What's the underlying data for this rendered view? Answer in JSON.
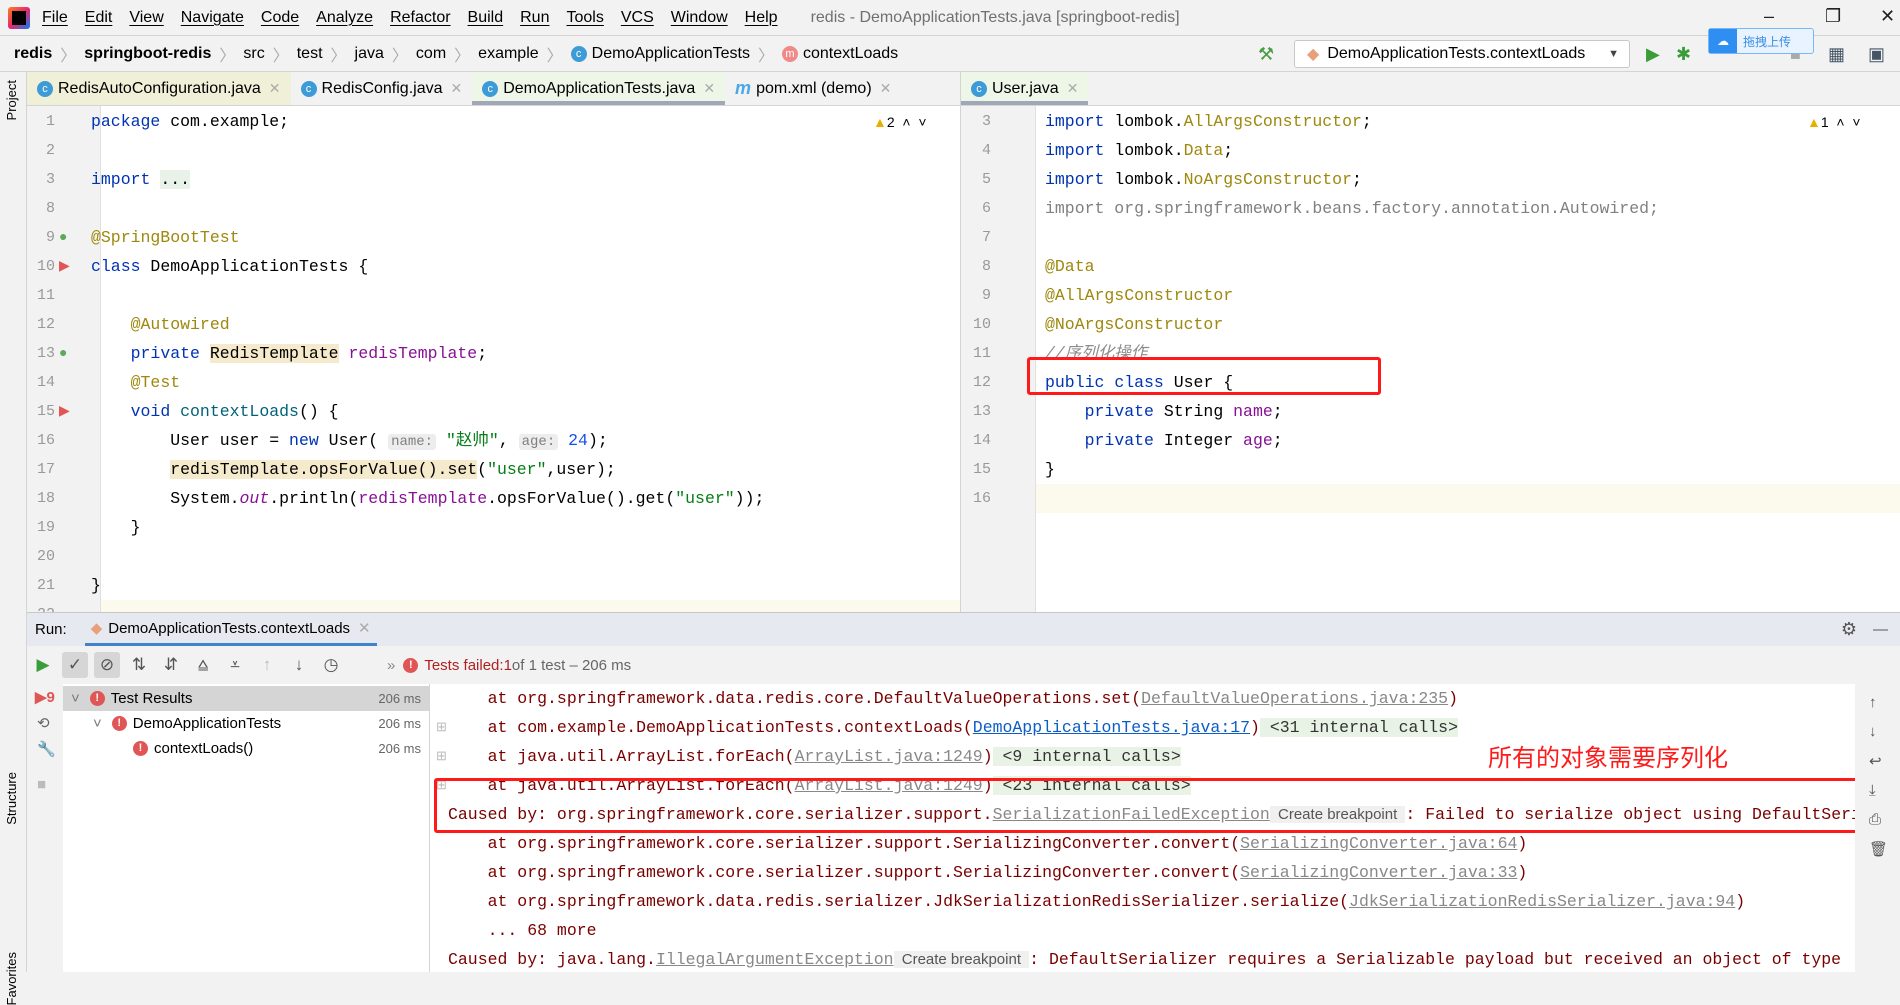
{
  "menu": {
    "items": [
      "File",
      "Edit",
      "View",
      "Navigate",
      "Code",
      "Analyze",
      "Refactor",
      "Build",
      "Run",
      "Tools",
      "VCS",
      "Window",
      "Help"
    ],
    "title": "redis - DemoApplicationTests.java [springboot-redis]"
  },
  "breadcrumb": [
    "redis",
    "springboot-redis",
    "src",
    "test",
    "java",
    "com",
    "example",
    "DemoApplicationTests",
    "contextLoads"
  ],
  "toolbar": {
    "run_config": "DemoApplicationTests.contextLoads",
    "upload_label": "拖拽上传"
  },
  "left_strip": {
    "project": "Project",
    "structure": "Structure",
    "favorites": "Favorites"
  },
  "left_tabs": [
    {
      "label": "RedisAutoConfiguration.java",
      "icon": "c"
    },
    {
      "label": "RedisConfig.java",
      "icon": "c"
    },
    {
      "label": "DemoApplicationTests.java",
      "icon": "c",
      "active": true
    },
    {
      "label": "pom.xml (demo)",
      "icon": "m"
    }
  ],
  "right_tabs": [
    {
      "label": "User.java",
      "icon": "c",
      "active": true
    }
  ],
  "left_editor": {
    "warnings": "2",
    "lines": [
      {
        "n": "1",
        "t": [
          [
            "package",
            "kw"
          ],
          [
            " com.example;",
            ""
          ]
        ]
      },
      {
        "n": "2",
        "t": []
      },
      {
        "n": "3",
        "t": [
          [
            "import",
            "kw"
          ],
          [
            " ",
            ""
          ],
          [
            "...",
            "fold"
          ]
        ]
      },
      {
        "n": "8",
        "t": []
      },
      {
        "n": "9",
        "t": [
          [
            "@SpringBootTest",
            "ann"
          ]
        ]
      },
      {
        "n": "10",
        "t": [
          [
            "class",
            "kw"
          ],
          [
            " DemoApplicationTests {",
            ""
          ]
        ]
      },
      {
        "n": "11",
        "t": []
      },
      {
        "n": "12",
        "t": [
          [
            "    ",
            ""
          ],
          [
            "@Autowired",
            "ann"
          ]
        ]
      },
      {
        "n": "13",
        "t": [
          [
            "    ",
            ""
          ],
          [
            "private",
            "kw"
          ],
          [
            " ",
            ""
          ],
          [
            "RedisTemplate",
            "hl"
          ],
          [
            " ",
            ""
          ],
          [
            "redisTemplate",
            "fld"
          ],
          [
            ";",
            ""
          ]
        ]
      },
      {
        "n": "14",
        "t": [
          [
            "    ",
            ""
          ],
          [
            "@Test",
            "ann"
          ]
        ]
      },
      {
        "n": "15",
        "t": [
          [
            "    ",
            ""
          ],
          [
            "void",
            "kw"
          ],
          [
            " ",
            ""
          ],
          [
            "contextLoads",
            "fn"
          ],
          [
            "() {",
            ""
          ]
        ]
      },
      {
        "n": "16",
        "t": [
          [
            "        User user = ",
            ""
          ],
          [
            "new",
            "kw"
          ],
          [
            " User( ",
            ""
          ],
          [
            "name:",
            "hint"
          ],
          [
            " ",
            ""
          ],
          [
            "\"赵帅\"",
            "str"
          ],
          [
            ", ",
            ""
          ],
          [
            "age:",
            "hint"
          ],
          [
            " ",
            ""
          ],
          [
            "24",
            "num"
          ],
          [
            ");",
            ""
          ]
        ]
      },
      {
        "n": "17",
        "t": [
          [
            "        ",
            ""
          ],
          [
            "redisTemplate.opsForValue().set",
            "hl"
          ],
          [
            "(",
            ""
          ],
          [
            "\"user\"",
            "str"
          ],
          [
            ",user);",
            ""
          ]
        ]
      },
      {
        "n": "18",
        "t": [
          [
            "        System.",
            ""
          ],
          [
            "out",
            "fld ital"
          ],
          [
            ".println(",
            ""
          ],
          [
            "redisTemplate",
            "fld"
          ],
          [
            ".opsForValue().get(",
            ""
          ],
          [
            "\"user\"",
            "str"
          ],
          [
            "));",
            ""
          ]
        ]
      },
      {
        "n": "19",
        "t": [
          [
            "    }",
            ""
          ]
        ]
      },
      {
        "n": "20",
        "t": []
      },
      {
        "n": "21",
        "t": [
          [
            "}",
            ""
          ]
        ]
      },
      {
        "n": "22",
        "t": []
      }
    ]
  },
  "right_editor": {
    "warnings": "1",
    "lines": [
      {
        "n": "3",
        "t": [
          [
            "import",
            "kw"
          ],
          [
            " lombok.",
            ""
          ],
          [
            "AllArgsConstructor",
            "ann"
          ],
          [
            ";",
            ""
          ]
        ]
      },
      {
        "n": "4",
        "t": [
          [
            "import",
            "kw"
          ],
          [
            " lombok.",
            ""
          ],
          [
            "Data",
            "ann"
          ],
          [
            ";",
            ""
          ]
        ]
      },
      {
        "n": "5",
        "t": [
          [
            "import",
            "kw"
          ],
          [
            " lombok.",
            ""
          ],
          [
            "NoArgsConstructor",
            "ann"
          ],
          [
            ";",
            ""
          ]
        ]
      },
      {
        "n": "6",
        "t": [
          [
            "import org.springframework.beans.factory.annotation.Autowired;",
            "dim"
          ]
        ]
      },
      {
        "n": "7",
        "t": []
      },
      {
        "n": "8",
        "t": [
          [
            "@Data",
            "ann"
          ]
        ]
      },
      {
        "n": "9",
        "t": [
          [
            "@AllArgsConstructor",
            "ann"
          ]
        ]
      },
      {
        "n": "10",
        "t": [
          [
            "@NoArgsConstructor",
            "ann"
          ]
        ]
      },
      {
        "n": "11",
        "t": [
          [
            "//序列化操作",
            "cmt"
          ]
        ]
      },
      {
        "n": "12",
        "t": [
          [
            "public",
            "kw"
          ],
          [
            " ",
            ""
          ],
          [
            "class",
            "kw"
          ],
          [
            " User {",
            ""
          ]
        ]
      },
      {
        "n": "13",
        "t": [
          [
            "    ",
            ""
          ],
          [
            "private",
            "kw"
          ],
          [
            " String ",
            ""
          ],
          [
            "name",
            "fld"
          ],
          [
            ";",
            ""
          ]
        ]
      },
      {
        "n": "14",
        "t": [
          [
            "    ",
            ""
          ],
          [
            "private",
            "kw"
          ],
          [
            " Integer ",
            ""
          ],
          [
            "age",
            "fld"
          ],
          [
            ";",
            ""
          ]
        ]
      },
      {
        "n": "15",
        "t": [
          [
            "}",
            ""
          ]
        ]
      },
      {
        "n": "16",
        "t": []
      }
    ]
  },
  "run": {
    "label": "Run:",
    "tab": "DemoApplicationTests.contextLoads",
    "status_prefix": "Tests failed: ",
    "status_failed": "1",
    "status_rest": " of 1 test – 206 ms",
    "tree": [
      {
        "label": "Test Results",
        "time": "206 ms"
      },
      {
        "label": "DemoApplicationTests",
        "time": "206 ms"
      },
      {
        "label": "contextLoads()",
        "time": "206 ms"
      }
    ]
  },
  "console": {
    "lines": [
      {
        "t": [
          [
            "    at org.springframework.data.redis.core.DefaultValueOperations.set(",
            ""
          ],
          [
            "DefaultValueOperations.java:235",
            "lnk"
          ],
          [
            ")",
            ""
          ]
        ]
      },
      {
        "fold": true,
        "t": [
          [
            "    at com.example.DemoApplicationTests.contextLoads(",
            ""
          ],
          [
            "DemoApplicationTests.java:17",
            "lnkb"
          ],
          [
            ")",
            ""
          ],
          [
            " <31 internal calls>",
            "ic"
          ]
        ]
      },
      {
        "fold": true,
        "t": [
          [
            "    at java.util.ArrayList.forEach(",
            ""
          ],
          [
            "ArrayList.java:1249",
            "lnk"
          ],
          [
            ")",
            ""
          ],
          [
            " <9 internal calls>",
            "ic"
          ]
        ]
      },
      {
        "fold": true,
        "t": [
          [
            "    at java.util.ArrayList.forEach(",
            ""
          ],
          [
            "ArrayList.java:1249",
            "lnk"
          ],
          [
            ")",
            ""
          ],
          [
            " <23 internal calls>",
            "ic"
          ]
        ]
      },
      {
        "t": [
          [
            "Caused by: org.springframework.core.serializer.support.",
            ""
          ],
          [
            "SerializationFailedException",
            "lnk"
          ],
          [
            " Create breakpoint ",
            "cb"
          ],
          [
            ": Failed to serialize object using DefaultSerializer",
            ""
          ]
        ]
      },
      {
        "t": [
          [
            "    at org.springframework.core.serializer.support.SerializingConverter.convert(",
            ""
          ],
          [
            "SerializingConverter.java:64",
            "lnk"
          ],
          [
            ")",
            ""
          ]
        ]
      },
      {
        "t": [
          [
            "    at org.springframework.core.serializer.support.SerializingConverter.convert(",
            ""
          ],
          [
            "SerializingConverter.java:33",
            "lnk"
          ],
          [
            ")",
            ""
          ]
        ]
      },
      {
        "t": [
          [
            "    at org.springframework.data.redis.serializer.JdkSerializationRedisSerializer.serialize(",
            ""
          ],
          [
            "JdkSerializationRedisSerializer.java:94",
            "lnk"
          ],
          [
            ")",
            ""
          ]
        ]
      },
      {
        "t": [
          [
            "    ... 68 more",
            ""
          ]
        ]
      },
      {
        "t": [
          [
            "Caused by: java.lang.",
            ""
          ],
          [
            "IllegalArgumentException",
            "lnk"
          ],
          [
            " Create breakpoint ",
            "cb"
          ],
          [
            ": DefaultSerializer requires a Serializable payload but received an object of type",
            ""
          ]
        ]
      }
    ]
  },
  "annotation": "所有的对象需要序列化",
  "colors": {
    "annotation_red": "#ff1a1a",
    "error_red": "#e05555",
    "keyword": "#0033b3"
  }
}
